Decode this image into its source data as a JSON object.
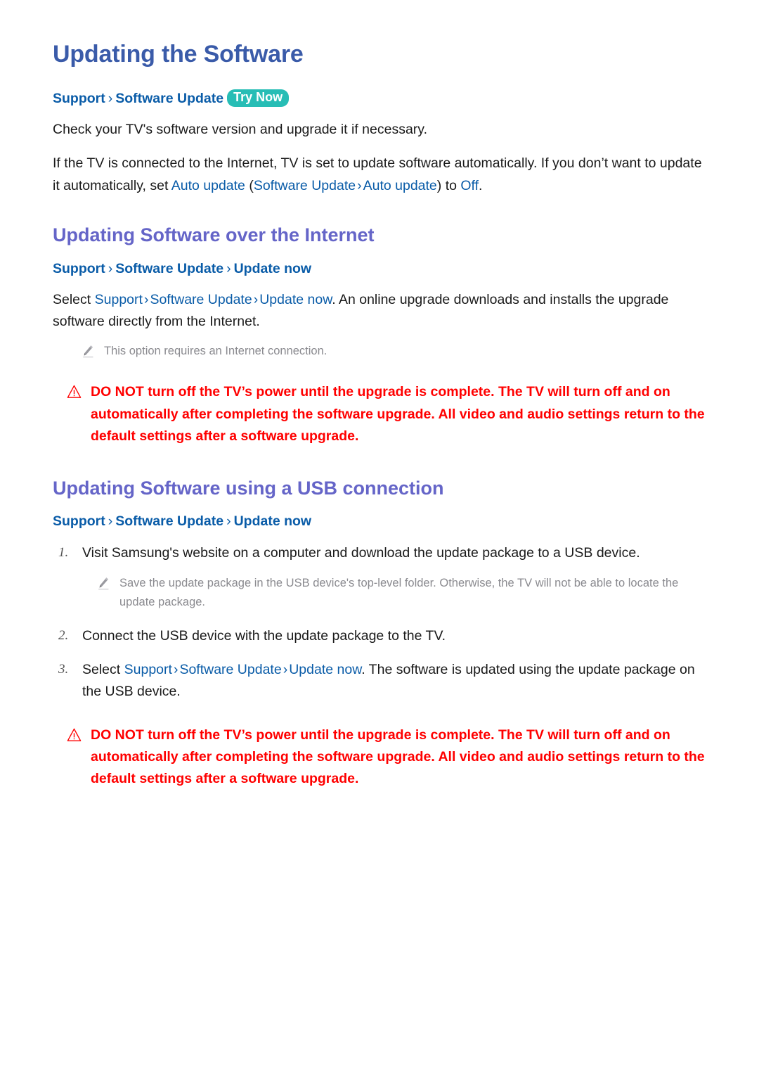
{
  "page": {
    "title": "Updating the Software"
  },
  "colors": {
    "title": "#3a5ba9",
    "section_heading": "#6565c8",
    "link": "#0a5ca8",
    "badge": "#27bdb5",
    "warning": "#ff0000",
    "note": "#8a8a8f"
  },
  "top": {
    "breadcrumb": {
      "crumb1": "Support",
      "sep1": "›",
      "crumb2": "Software Update",
      "badge": "Try Now"
    },
    "para1": "Check your TV's software version and upgrade it if necessary.",
    "para2": {
      "t1": "If the TV is connected to the Internet, TV is set to update software automatically. If you don’t want to update it automatically, set ",
      "link1": "Auto update",
      "t2": " (",
      "link2": "Software Update",
      "sep": "›",
      "link3": "Auto update",
      "t3": ") to ",
      "link4": "Off",
      "t4": "."
    }
  },
  "section_internet": {
    "heading": "Updating Software over the Internet",
    "breadcrumb": {
      "crumb1": "Support",
      "sep1": "›",
      "crumb2": "Software Update",
      "sep2": "›",
      "crumb3": "Update now"
    },
    "para": {
      "t1": "Select ",
      "link1": "Support",
      "sep1": "›",
      "link2": "Software Update",
      "sep2": "›",
      "link3": "Update now",
      "t2": ". An online upgrade downloads and installs the upgrade software directly from the Internet."
    },
    "note": "This option requires an Internet connection.",
    "warning": "DO NOT turn off the TV’s power until the upgrade is complete. The TV will turn off and on automatically after completing the software upgrade. All video and audio settings return to the default settings after a software upgrade."
  },
  "section_usb": {
    "heading": "Updating Software using a USB connection",
    "breadcrumb": {
      "crumb1": "Support",
      "sep1": "›",
      "crumb2": "Software Update",
      "sep2": "›",
      "crumb3": "Update now"
    },
    "steps": [
      {
        "num": "1.",
        "text": "Visit Samsung's website on a computer and download the update package to a USB device.",
        "note": "Save the update package in the USB device's top-level folder. Otherwise, the TV will not be able to locate the update package."
      },
      {
        "num": "2.",
        "text": "Connect the USB device with the update package to the TV."
      },
      {
        "num": "3.",
        "prefix": "Select ",
        "link1": "Support",
        "sep1": "›",
        "link2": "Software Update",
        "sep2": "›",
        "link3": "Update now",
        "suffix": ". The software is updated using the update package on the USB device."
      }
    ],
    "warning": "DO NOT turn off the TV’s power until the upgrade is complete. The TV will turn off and on automatically after completing the software upgrade. All video and audio settings return to the default settings after a software upgrade."
  },
  "icons": {
    "pencil": "pencil-icon",
    "warning": "warning-triangle-icon"
  }
}
